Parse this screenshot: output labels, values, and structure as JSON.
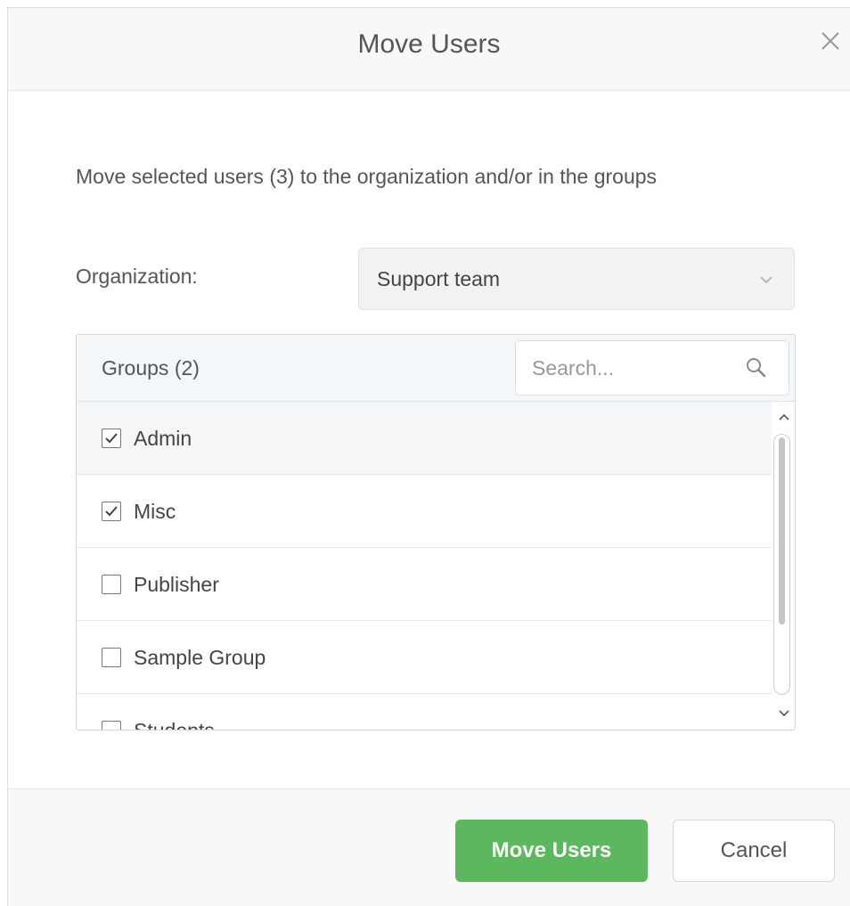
{
  "dialog": {
    "title": "Move Users",
    "close_icon": "close-icon",
    "intro_text": "Move selected users (3) to the organization and/or in the groups"
  },
  "organization": {
    "label": "Organization:",
    "selected": "Support team",
    "chevron_icon": "chevron-down-icon"
  },
  "groups": {
    "title": "Groups (2)",
    "search_placeholder": "Search...",
    "search_icon": "search-icon",
    "items": [
      {
        "label": "Admin",
        "checked": true
      },
      {
        "label": "Misc",
        "checked": true
      },
      {
        "label": "Publisher",
        "checked": false
      },
      {
        "label": "Sample Group",
        "checked": false
      },
      {
        "label": "Students",
        "checked": false
      }
    ]
  },
  "footer": {
    "primary_label": "Move Users",
    "cancel_label": "Cancel"
  },
  "colors": {
    "primary": "#5cb85c",
    "header_bg": "#f8f8f8",
    "select_bg": "#f2f2f2"
  }
}
